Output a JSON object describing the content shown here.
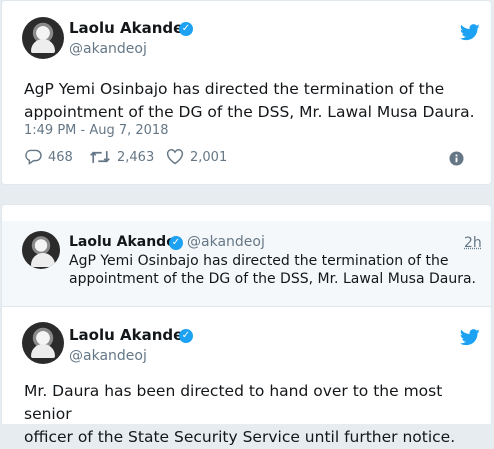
{
  "colors": {
    "brand_blue": "#1da1f2",
    "muted": "#657786",
    "text": "#14171a",
    "background": "#e6ecf0"
  },
  "tweet1": {
    "name": "Laolu Akande",
    "handle": "@akandeoj",
    "text_line1": "AgP Yemi Osinbajo has directed the termination of the",
    "text_line2": "appointment of the DG of the DSS, Mr. Lawal Musa Daura.",
    "timestamp": "1:49 PM - Aug 7, 2018",
    "replies": "468",
    "retweets": "2,463",
    "likes": "2,001",
    "icons": [
      "twitter-bird-icon",
      "verified-icon",
      "reply-icon",
      "retweet-icon",
      "heart-icon",
      "info-icon"
    ]
  },
  "quoted_tweet": {
    "name": "Laolu Akande",
    "handle": "@akandeoj",
    "time_ago": "2h",
    "text_line1": "AgP Yemi Osinbajo has directed the termination of the",
    "text_line2": "appointment of the DG of the DSS, Mr. Lawal Musa Daura."
  },
  "tweet2": {
    "name": "Laolu Akande",
    "handle": "@akandeoj",
    "text_line1": "Mr. Daura has been directed to hand over to the most senior",
    "text_line2": "officer of the State Security Service until further notice."
  }
}
